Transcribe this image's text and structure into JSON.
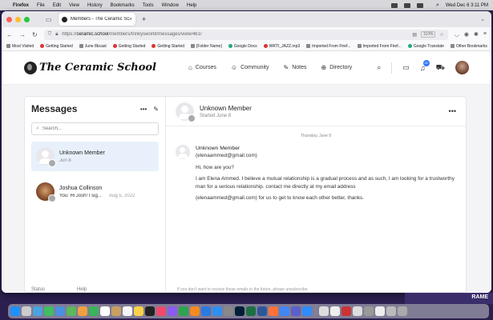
{
  "menubar": {
    "app": "Firefox",
    "items": [
      "File",
      "Edit",
      "View",
      "History",
      "Bookmarks",
      "Tools",
      "Window",
      "Help"
    ],
    "clock": "Wed Dec 6  3:11 PM"
  },
  "browser": {
    "tab_title": "Members - The Ceramic School",
    "url_prefix": "https://",
    "url_domain": "ceramic.school",
    "url_path": "/members/trinkysworld/messages/view/461/",
    "zoom": "110%",
    "bookmarks": [
      "Most Visited",
      "Getting Started",
      "June 8bcast",
      "Getting Started",
      "Getting Started",
      "[Folder Name]",
      "Google Docs",
      "WRTI_JAZZ.mp3",
      "Imported From Firef...",
      "Imported From Firef...",
      "Google Translate"
    ],
    "other_bookmarks": "Other Bookmarks"
  },
  "site": {
    "logo_text": "The Ceramic School",
    "nav": [
      {
        "icon": "courses-icon",
        "label": "Courses"
      },
      {
        "icon": "community-icon",
        "label": "Community"
      },
      {
        "icon": "notes-icon",
        "label": "Notes"
      },
      {
        "icon": "directory-icon",
        "label": "Directory"
      }
    ],
    "notification_count": "32"
  },
  "messages": {
    "title": "Messages",
    "search_placeholder": "Search...",
    "conversations": [
      {
        "name": "Unknown Member",
        "preview": "",
        "date": "Jun 8",
        "active": true
      },
      {
        "name": "Joshua Collinson",
        "preview": "You: Hi Josh! I sig...",
        "date": "Aug 5, 2022",
        "active": false
      }
    ],
    "footer_left": "Status",
    "footer_right": "Help"
  },
  "thread": {
    "name": "Unknown Member",
    "started": "Started June 8",
    "date_separator": "Thursday, June 8",
    "sender": "Unknown Member",
    "sender_email": "(elenaammed@gmail.com)",
    "lines": [
      "Hi, how are you?",
      "I am Elena Ammed. I believe a mutual relationship is a gradual process and as such, I am looking for a trustworthy man for a serious relationship. contact me directly at my email address",
      "(elenaammed@gmail.com) for us to get to know each other better, thanks."
    ],
    "unsubscribe_note": "If you don't want to receive these emails in the future, please unsubscribe."
  },
  "background_window_label": "RAME"
}
